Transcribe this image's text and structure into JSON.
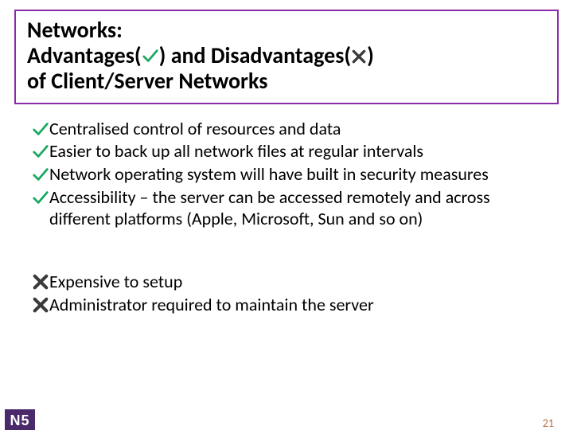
{
  "title": {
    "line1": "Networks:",
    "line2a": "Advantages(",
    "line2b": ") and Disadvantages(",
    "line2c": ")",
    "line3": "of Client/Server Networks"
  },
  "advantages": [
    "Centralised control of resources and data",
    "Easier to back up all network files at regular intervals",
    "Network operating system will have built in security measures",
    "Accessibility – the server can be accessed remotely and across different platforms (Apple, Microsoft, Sun and so on)"
  ],
  "disadvantages": [
    "Expensive to setup",
    "Administrator required to maintain the server"
  ],
  "pageNumber": "21",
  "logo": "N5",
  "icons": {
    "tick": "tick-icon",
    "cross": "cross-icon"
  },
  "colors": {
    "border": "#8b2aa6",
    "tick": "#17a85f",
    "cross": "#3a3a3a",
    "pageNum": "#b56a3f",
    "logoBg": "#4a2a6a"
  }
}
